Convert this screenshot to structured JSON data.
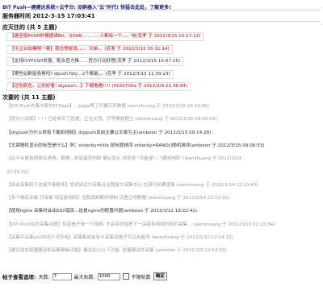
{
  "header": {
    "banner": "BIT Push—建建达系统+云平台: 动群器入\"云\"时代! 快猛击此处，了解更多!",
    "server_time": "服务器时间  2012-3-15 17:03:41"
  },
  "pinned": {
    "title": "应灭往的 (共 5 主题)",
    "rows": [
      {
        "text": "【建全版PUSH的模据请Bit，QQ98……",
        "meta": "……人都绘一个。。。呐(克孝 于 2012/3/15 15:17:12)",
        "style": "red",
        "box": true
      },
      {
        "text": "【平企业加模相一案】我也想是戏。",
        "meta": "。。。兄弟。。(克孝 于 2012/3/15 15:11:14)",
        "style": "red",
        "box": true
      },
      {
        "text": "【支持DIYPUSH发展、配合官方推",
        "meta": "……官方行动好理(克孝 于 2012/3/15 15:07:25)",
        "style": "dark",
        "box": true
      },
      {
        "text": "【哪些站群能免换吗? dpush7diy…",
        "meta": "2个都能。。(克孝 于 2012/3/15 11:39:23)",
        "style": "dark",
        "box": true
      },
      {
        "text": "【还你颜色，让你好看! diypush…】",
        "meta": "下载看看!!!! (4102700a 于 2012/3/9 21:36:04)",
        "style": "red",
        "box": true
      }
    ]
  },
  "recent": {
    "title": "次要的 (共 11 主题)",
    "rows": [
      {
        "text": "【DIY Push大集大家的IT-Page】…",
        "meta": "page等了开要示页数据 (wenshuang 于 2013/3/15 16:19:00)",
        "style": "grey"
      },
      {
        "text": "【绝对小说版】! ! ! 已经收到了答速，",
        "meta": "正在交流，尽早模收题主 (wenshuang 于 2013/3/15 16:10:04)",
        "style": "grey"
      },
      {
        "text": "【diypush为什么很有下载和视频】",
        "meta": "diypush目前主要以文章为主(amboon 于 2012/3/15 09:14:28)",
        "style": "dark"
      },
      {
        "text": "【文章随机显示的标签是什么】例：orderby=title 按标题排序 orderby=RAND()",
        "meta": "随机排序(amboon 于 2012/3/15 09:06:53)",
        "style": "dark"
      },
      {
        "text": "【云平台更有网络名来熟，数据…",
        "meta": "到底能否判断 确认显示 说到这 \"可能谨\"，\"通信网络\" (wenshuang 于 2012/3/14",
        "style": "grey"
      },
      {
        "text": "22:35:32)",
        "meta": "",
        "style": "grey"
      },
      {
        "text": "【自此采集和于这是不能群多】",
        "meta": "誉说到过方采集且当我是大采集中心 在研讨如果里面 (wenshuang 于 2012/3/14 22:23:45)",
        "style": "grey"
      },
      {
        "text": "【多个相目采集 只采集 规定是相同】",
        "meta": "当我说判断的规制 设置让吧数据 (wenshuang 于 2012/3/14 22:10:31)",
        "style": "grey"
      },
      {
        "text": "【使用nginx 采集时会出502错误…",
        "meta": "这是nginx的配置问题(amboon 于 2012/3/12 18:22:42)",
        "style": "dark"
      },
      {
        "text": "【DIY Push站的采集问题】",
        "meta": "知道是只单一个视频, 才会有凯就把下一关链有视频的网页采集… (wenshuang 于 2012/3/10 22:23:34)",
        "style": "grey"
      },
      {
        "text": "【采集平采集xxx中间于可所有】",
        "meta": "采集集成会有平采集设施于可以有能所 (wenshuang 于 2012/3/10 22:14:32)",
        "style": "grey"
      },
      {
        "text": "【建议增加按量搬运和采集模板功能】",
        "meta": "建议加入以下功能: 批量搬运并采集 (amboon 于 2012/3/9 12:54:59)",
        "style": "grey"
      }
    ]
  },
  "filter": {
    "title": "帖子查看选项:",
    "days_label": "天数:",
    "days_value": "7",
    "max_label": "最大贴数:",
    "max_value": "1000",
    "unlimited_label": "不限帖数",
    "submit_label": "确定"
  }
}
